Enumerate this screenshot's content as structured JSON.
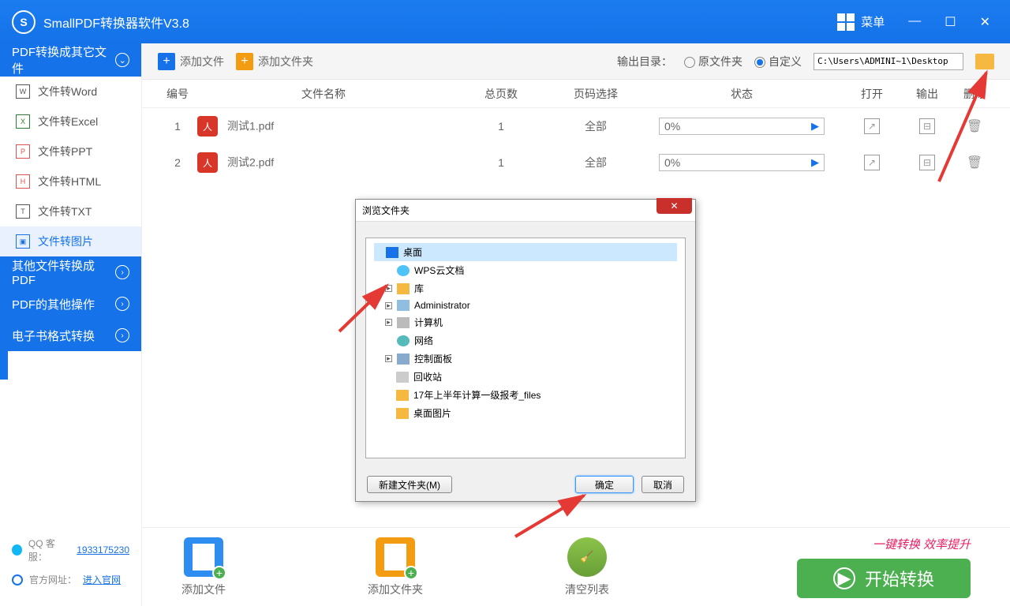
{
  "app": {
    "title": "SmallPDF转换器软件V3.8",
    "menu": "菜单"
  },
  "sidebar": {
    "header": "PDF转换成其它文件",
    "items": [
      {
        "label": "文件转Word",
        "icon": "W"
      },
      {
        "label": "文件转Excel",
        "icon": "X"
      },
      {
        "label": "文件转PPT",
        "icon": "P"
      },
      {
        "label": "文件转HTML",
        "icon": "H"
      },
      {
        "label": "文件转TXT",
        "icon": "T"
      },
      {
        "label": "文件转图片",
        "icon": "▣"
      }
    ],
    "cats": [
      "其他文件转换成PDF",
      "PDF的其他操作",
      "电子书格式转换"
    ],
    "footer": {
      "qq_label": "QQ 客服：",
      "qq_num": "1933175230",
      "site_label": "官方网址：",
      "site_link": "进入官网"
    }
  },
  "toolbar": {
    "add_file": "添加文件",
    "add_folder": "添加文件夹",
    "out_label": "输出目录：",
    "opt_original": "原文件夹",
    "opt_custom": "自定义",
    "path": "C:\\Users\\ADMINI~1\\Desktop"
  },
  "table": {
    "headers": {
      "no": "编号",
      "name": "文件名称",
      "pages": "总页数",
      "sel": "页码选择",
      "status": "状态",
      "open": "打开",
      "out": "输出",
      "del": "删除"
    },
    "rows": [
      {
        "no": "1",
        "name": "测试1.pdf",
        "pages": "1",
        "sel": "全部",
        "status": "0%"
      },
      {
        "no": "2",
        "name": "测试2.pdf",
        "pages": "1",
        "sel": "全部",
        "status": "0%"
      }
    ]
  },
  "bottom": {
    "add_file": "添加文件",
    "add_folder": "添加文件夹",
    "clear": "清空列表",
    "slogan": "一键转换  效率提升",
    "start": "开始转换"
  },
  "modal": {
    "title": "浏览文件夹",
    "items": [
      "桌面",
      "WPS云文档",
      "库",
      "Administrator",
      "计算机",
      "网络",
      "控制面板",
      "回收站",
      "17年上半年计算一级报考_files",
      "桌面图片"
    ],
    "new_folder": "新建文件夹(M)",
    "ok": "确定",
    "cancel": "取消"
  }
}
